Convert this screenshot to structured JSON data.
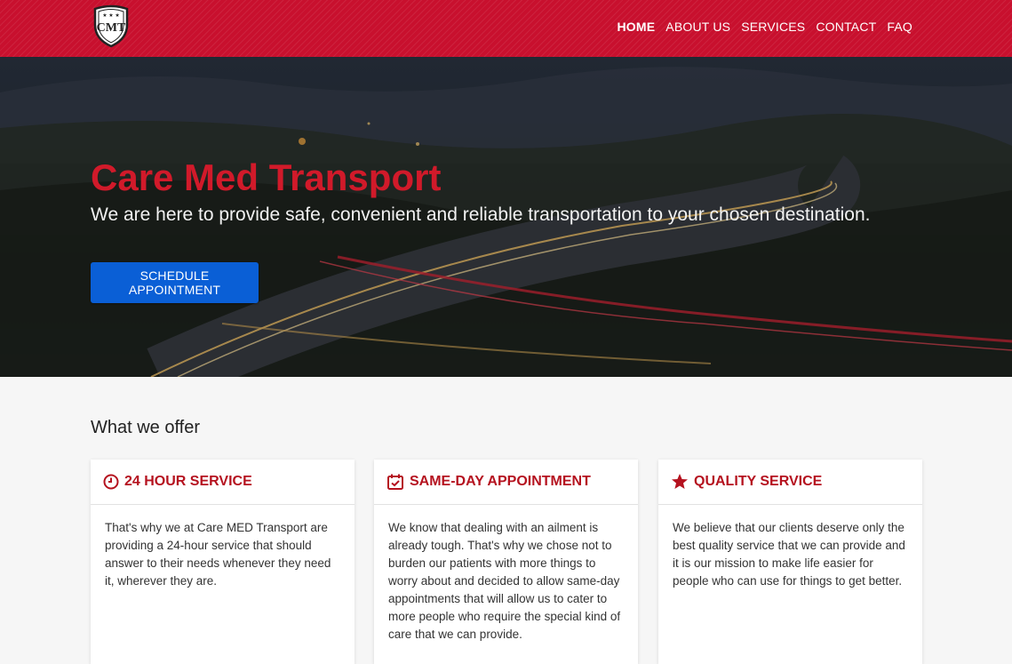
{
  "header": {
    "logo_text": "CMT",
    "nav": [
      {
        "label": "HOME"
      },
      {
        "label": "ABOUT US"
      },
      {
        "label": "SERVICES"
      },
      {
        "label": "CONTACT"
      },
      {
        "label": "FAQ"
      }
    ]
  },
  "hero": {
    "title": "Care Med Transport",
    "subtitle": "We are here to provide safe, convenient and reliable transportation to your chosen destination.",
    "cta_label": "SCHEDULE APPOINTMENT"
  },
  "offer": {
    "heading": "What we offer",
    "cards": [
      {
        "icon": "clock-icon",
        "title": "24 HOUR SERVICE",
        "body": "That's why we at Care MED Transport are providing a 24-hour service that should answer to their needs whenever they need it, wherever they are."
      },
      {
        "icon": "calendar-check-icon",
        "title": "SAME-DAY APPOINTMENT",
        "body": "We know that dealing with an ailment is already tough. That's why we chose not to burden our patients with more things to worry about and decided to allow same-day appointments that will allow us to cater to more people who require the special kind of care that we can provide."
      },
      {
        "icon": "star-icon",
        "title": "QUALITY SERVICE",
        "body": "We believe that our clients deserve only the best quality service that we can provide and it is our mission to make life easier for people who can use for things to get better."
      }
    ]
  },
  "colors": {
    "brand_red": "#c8102e",
    "title_red": "#d11a2a",
    "cta_blue": "#0a5fd6"
  }
}
